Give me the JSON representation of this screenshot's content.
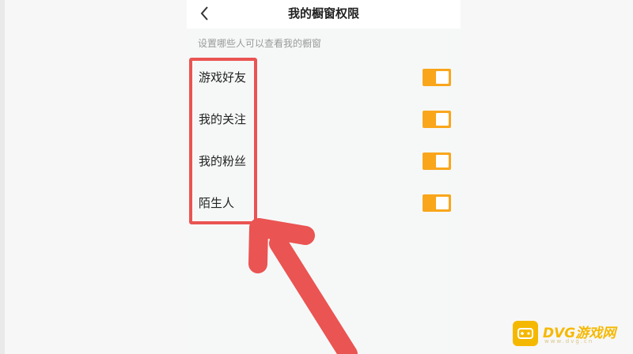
{
  "nav": {
    "title": "我的橱窗权限",
    "back_icon": "chevron-left-icon"
  },
  "section_hint": "设置哪些人可以查看我的橱窗",
  "rows": [
    {
      "label": "游戏好友",
      "enabled": true
    },
    {
      "label": "我的关注",
      "enabled": true
    },
    {
      "label": "我的粉丝",
      "enabled": true
    },
    {
      "label": "陌生人",
      "enabled": true
    }
  ],
  "colors": {
    "toggle_on": "#f9a61b",
    "highlight": "#ea5452",
    "watermark": "#f5b800"
  },
  "watermark": {
    "brand": "DVG游戏网",
    "sub": "www.dvg.cn"
  }
}
